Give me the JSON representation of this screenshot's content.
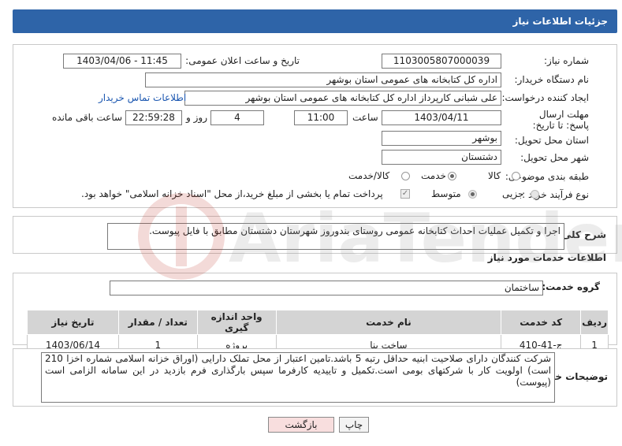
{
  "header": {
    "title": "جزئیات اطلاعات نیاز"
  },
  "form": {
    "need_number_label": "شماره نیاز:",
    "need_number": "1103005807000039",
    "announce_label": "تاریخ و ساعت اعلان عمومی:",
    "announce_value": "1403/04/06 - 11:45",
    "buyer_org_label": "نام دستگاه خریدار:",
    "buyer_org": "اداره کل کتابخانه های عمومی استان بوشهر",
    "requester_label": "ایجاد کننده درخواست:",
    "requester": "علی شبانی کارپرداز اداره کل کتابخانه های عمومی استان بوشهر",
    "contact_link": "اطلاعات تماس خریدار",
    "deadline_label": "مهلت ارسال پاسخ: تا تاریخ:",
    "deadline_date": "1403/04/11",
    "time_label": "ساعت",
    "deadline_time": "11:00",
    "days_value": "4",
    "days_label": "روز و",
    "remaining_time": "22:59:28",
    "remaining_label": "ساعت باقی مانده",
    "province_label": "استان محل تحویل:",
    "province": "بوشهر",
    "city_label": "شهر محل تحویل:",
    "city": "دشتستان",
    "category_label": "طبقه بندی موضوعی:",
    "category_options": [
      "کالا",
      "خدمت",
      "کالا/خدمت"
    ],
    "category_selected": "خدمت",
    "process_label": "نوع فرآیند خرید :",
    "process_options": [
      "جزیی",
      "متوسط"
    ],
    "process_selected": "متوسط",
    "payment_note": "پرداخت تمام یا بخشی از مبلغ خرید،از محل \"اسناد خزانه اسلامی\" خواهد بود."
  },
  "description": {
    "label": "شرح کلی نیاز:",
    "text": "اجرا و تکمیل عملیات احداث کتابخانه عمومی روستای بندوروز شهرستان دشتستان مطابق با فایل پیوست."
  },
  "services": {
    "heading": "اطلاعات خدمات مورد نیاز",
    "group_label": "گروه خدمت:",
    "group_value": "ساختمان",
    "columns": [
      "ردیف",
      "کد خدمت",
      "نام خدمت",
      "واحد اندازه گیری",
      "تعداد / مقدار",
      "تاریخ نیاز"
    ],
    "rows": [
      {
        "row": "1",
        "code": "ج-41-410",
        "name": "ساخت بنا",
        "unit": "پروژه",
        "qty": "1",
        "date": "1403/06/14"
      }
    ]
  },
  "buyer_notes": {
    "label": "توضیحات خریدار:",
    "text": "شرکت کنندگان دارای صلاحیت ابنیه حداقل رتبه 5 باشد.تامین اعتبار از محل تملک دارایی (اوراق خزانه اسلامی شماره اخزا 210 است) اولویت کار با شرکتهای بومی است.تکمیل و تاییدیه کارفرما سپس بارگذاری فرم بازدید در این سامانه الزامی است (پیوست)"
  },
  "buttons": {
    "print": "چاپ",
    "back": "بازگشت"
  },
  "watermark": {
    "text": "AriaTender.neT"
  },
  "colors": {
    "header_bg": "#2e64a8",
    "link": "#1a56b0",
    "back_button_bg": "#f8dede",
    "watermark": "#c0392b"
  }
}
